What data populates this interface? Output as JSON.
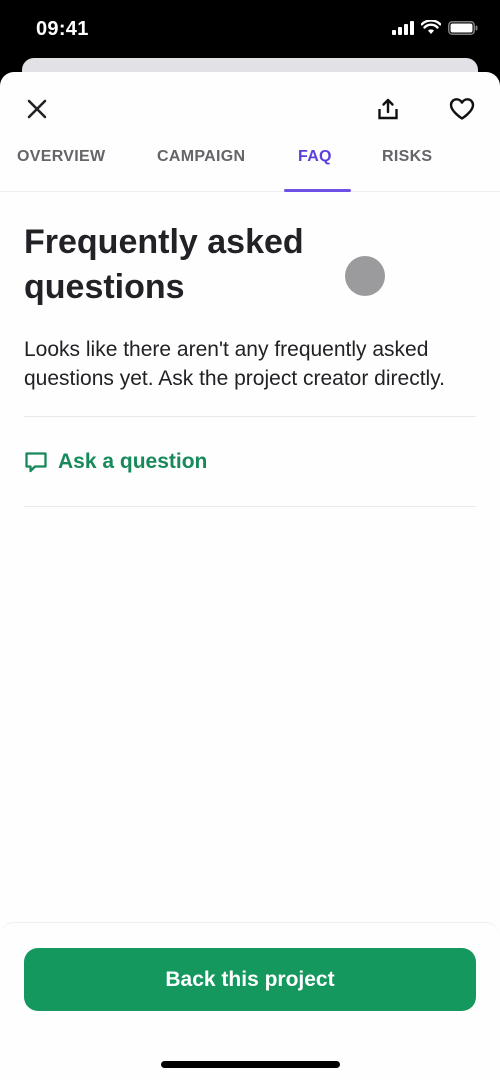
{
  "status_bar": {
    "time": "09:41",
    "icons": [
      "signal-icon",
      "wifi-icon",
      "battery-icon"
    ]
  },
  "toolbar": {
    "close_icon": "close-icon",
    "share_icon": "share-icon",
    "favorite_icon": "heart-icon"
  },
  "tabs": [
    {
      "label": "OVERVIEW",
      "active": false
    },
    {
      "label": "CAMPAIGN",
      "active": false
    },
    {
      "label": "FAQ",
      "active": true
    },
    {
      "label": "RISKS",
      "active": false
    }
  ],
  "main": {
    "title": "Frequently asked questions",
    "description": "Looks like there aren't any frequently asked questions yet. Ask the project creator directly.",
    "ask_label": "Ask a question",
    "ask_icon": "chat-bubble-icon"
  },
  "footer": {
    "cta_label": "Back this project"
  },
  "colors": {
    "accent": "#5a3fe0",
    "green": "#14985e",
    "link_green": "#17895a",
    "text": "#222226",
    "tab_inactive": "#646469"
  }
}
